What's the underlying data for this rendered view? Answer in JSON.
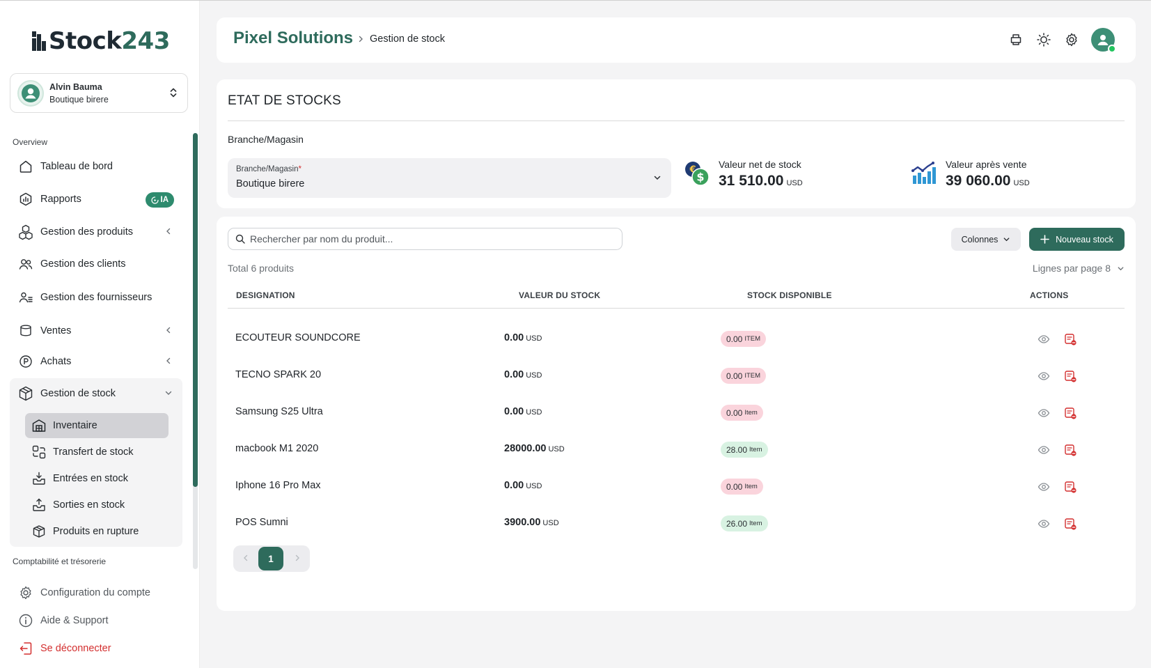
{
  "logo": {
    "part1": "Stock",
    "part2": "243"
  },
  "user": {
    "name": "Alvin Bauma",
    "shop": "Boutique birere"
  },
  "sidebar": {
    "overview_label": "Overview",
    "items": [
      {
        "label": "Tableau de bord"
      },
      {
        "label": "Rapports",
        "badge": "IA"
      },
      {
        "label": "Gestion des produits"
      },
      {
        "label": "Gestion des clients"
      },
      {
        "label": "Gestion des fournisseurs"
      },
      {
        "label": "Ventes"
      },
      {
        "label": "Achats"
      },
      {
        "label": "Gestion de stock"
      }
    ],
    "stock_sub": [
      {
        "label": "Inventaire"
      },
      {
        "label": "Transfert de stock"
      },
      {
        "label": "Entrées en stock"
      },
      {
        "label": "Sorties en stock"
      },
      {
        "label": "Produits en rupture"
      }
    ],
    "accounting_label": "Comptabilité et trésorerie",
    "bottom": [
      {
        "label": "Configuration du compte"
      },
      {
        "label": "Aide & Support"
      },
      {
        "label": "Se déconnecter"
      }
    ]
  },
  "header": {
    "brand": "Pixel Solutions",
    "breadcrumb": "Gestion de stock"
  },
  "summary": {
    "title": "ETAT DE STOCKS",
    "branch_label": "Branche/Magasin",
    "select": {
      "caption": "Branche/Magasin",
      "required_mark": "*",
      "value": "Boutique birere"
    },
    "net_value": {
      "label": "Valeur net de stock",
      "value": "31 510.00",
      "currency": "USD"
    },
    "after_sale": {
      "label": "Valeur après vente",
      "value": "39 060.00",
      "currency": "USD"
    }
  },
  "table": {
    "search_placeholder": "Rechercher par nom du produit...",
    "columns_button": "Colonnes",
    "new_button": "Nouveau stock",
    "total": "Total 6 produits",
    "per_page": "Lignes par page 8",
    "headers": [
      "DESIGNATION",
      "VALEUR DU STOCK",
      "STOCK DISPONIBLE",
      "ACTIONS"
    ],
    "rows": [
      {
        "name": "ECOUTEUR SOUNDCORE",
        "value": "0.00",
        "currency": "USD",
        "stock": "0.00",
        "unit": "ITEM",
        "status": "red"
      },
      {
        "name": "TECNO SPARK 20",
        "value": "0.00",
        "currency": "USD",
        "stock": "0.00",
        "unit": "ITEM",
        "status": "red"
      },
      {
        "name": "Samsung S25 Ultra",
        "value": "0.00",
        "currency": "USD",
        "stock": "0.00",
        "unit": "Item",
        "status": "red"
      },
      {
        "name": "macbook M1 2020",
        "value": "28000.00",
        "currency": "USD",
        "stock": "28.00",
        "unit": "Item",
        "status": "green"
      },
      {
        "name": "Iphone 16 Pro Max",
        "value": "0.00",
        "currency": "USD",
        "stock": "0.00",
        "unit": "Item",
        "status": "red"
      },
      {
        "name": "POS Sumni",
        "value": "3900.00",
        "currency": "USD",
        "stock": "26.00",
        "unit": "Item",
        "status": "green"
      }
    ],
    "current_page": "1"
  },
  "colors": {
    "primary": "#2e6b5c",
    "badge_green": "#2e8b6e",
    "chip_red_bg": "#fad4dc",
    "chip_green_bg": "#d8f2e2",
    "danger": "#d32f2f"
  }
}
